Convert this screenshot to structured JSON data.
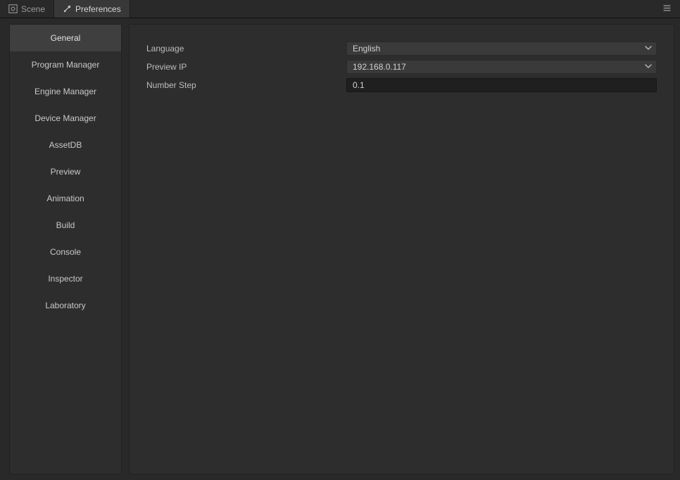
{
  "tabs": [
    {
      "label": "Scene",
      "active": false
    },
    {
      "label": "Preferences",
      "active": true
    }
  ],
  "sidebar": {
    "items": [
      {
        "label": "General",
        "active": true
      },
      {
        "label": "Program Manager",
        "active": false
      },
      {
        "label": "Engine Manager",
        "active": false
      },
      {
        "label": "Device Manager",
        "active": false
      },
      {
        "label": "AssetDB",
        "active": false
      },
      {
        "label": "Preview",
        "active": false
      },
      {
        "label": "Animation",
        "active": false
      },
      {
        "label": "Build",
        "active": false
      },
      {
        "label": "Console",
        "active": false
      },
      {
        "label": "Inspector",
        "active": false
      },
      {
        "label": "Laboratory",
        "active": false
      }
    ]
  },
  "fields": {
    "language": {
      "label": "Language",
      "value": "English"
    },
    "preview_ip": {
      "label": "Preview IP",
      "value": "192.168.0.117"
    },
    "number_step": {
      "label": "Number Step",
      "value": "0.1"
    }
  }
}
